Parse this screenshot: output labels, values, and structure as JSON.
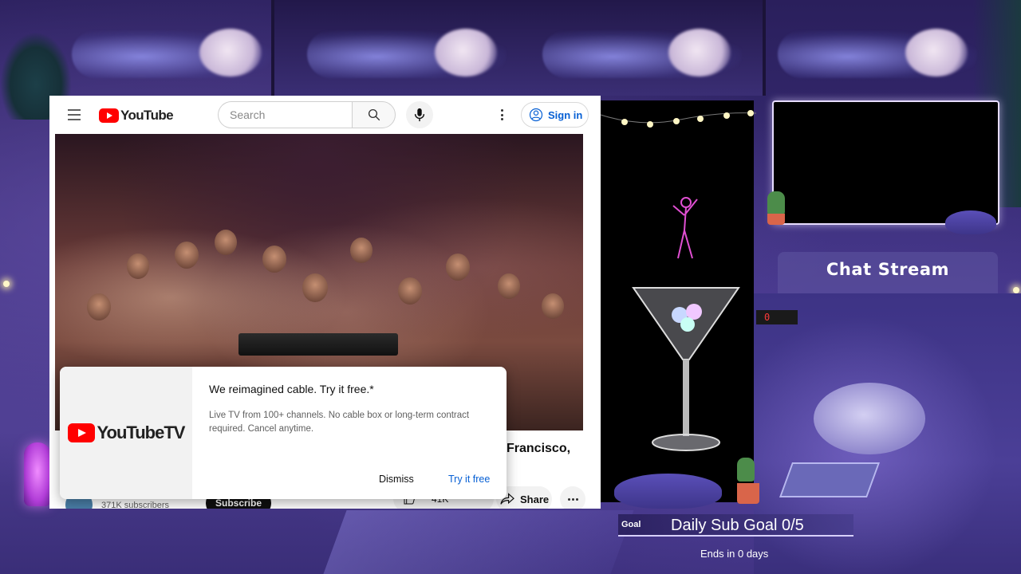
{
  "youtube": {
    "logo_text": "YouTube",
    "search": {
      "placeholder": "Search"
    },
    "sign_in_label": "Sign in",
    "video_title_fragment": "Francisco,",
    "channel": {
      "subscribers": "371K subscribers",
      "subscribe_label": "Subscribe"
    },
    "actions": {
      "like_count": "41K",
      "share_label": "Share"
    },
    "promo": {
      "logo_text": "YouTubeTV",
      "heading": "We reimagined cable. Try it free.*",
      "body": "Live TV from 100+ channels. No cable box or long-term contract required. Cancel anytime.",
      "dismiss_label": "Dismiss",
      "try_label": "Try it free"
    }
  },
  "overlay": {
    "chat_title": "Chat Stream",
    "clock_text": "0",
    "goal": {
      "label": "Goal",
      "text": "Daily Sub Goal 0/5",
      "ends": "Ends in 0 days",
      "progress": 0
    }
  },
  "colors": {
    "youtube_red": "#ff0000",
    "link_blue": "#065fd4",
    "overlay_purple": "#3b2f7a"
  }
}
